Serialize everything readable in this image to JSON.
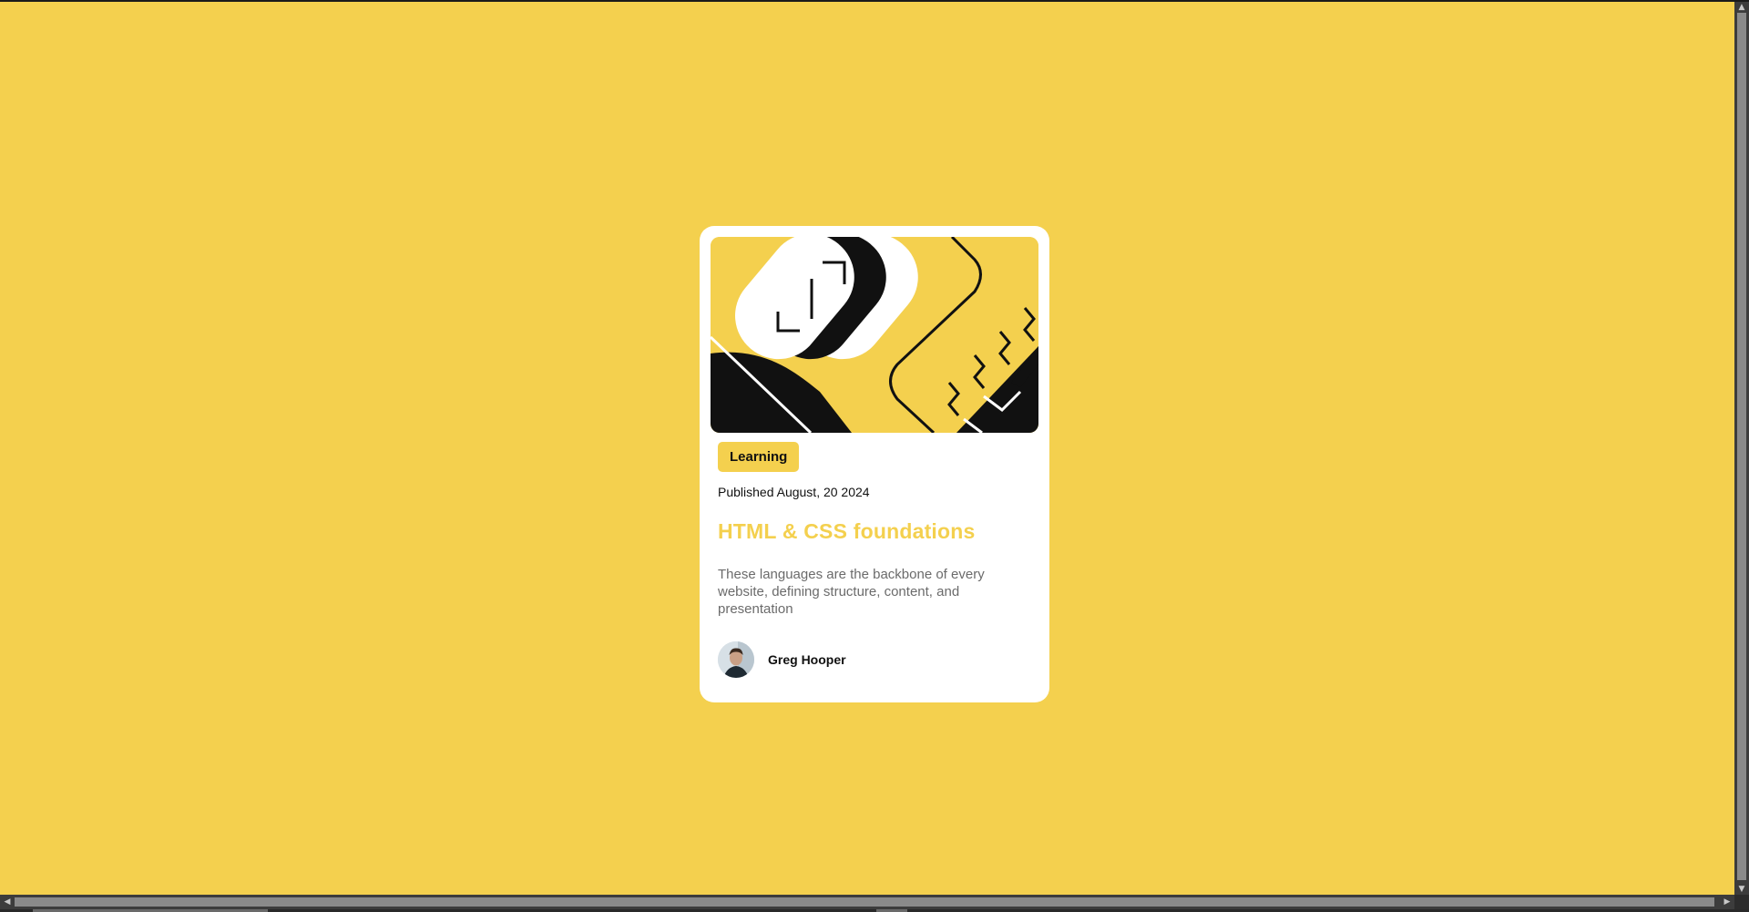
{
  "page": {
    "background_color": "#f4d04e"
  },
  "card": {
    "tag": "Learning",
    "published": "Published August, 20 2024",
    "title": "HTML & CSS foundations",
    "description": "These languages are the backbone of every website, defining structure, content, and presentation",
    "author": {
      "name": "Greg Hooper",
      "avatar_icon": "avatar-photo"
    },
    "hero_icon": "code-brackets-illustration",
    "colors": {
      "accent": "#f4d04e",
      "text": "#111111",
      "muted": "#6b6b6b",
      "card": "#ffffff"
    }
  },
  "scrollbars": {
    "vertical": {
      "up_icon": "▲",
      "down_icon": "▼"
    },
    "horizontal": {
      "left_icon": "◀",
      "right_icon": "▶"
    }
  }
}
